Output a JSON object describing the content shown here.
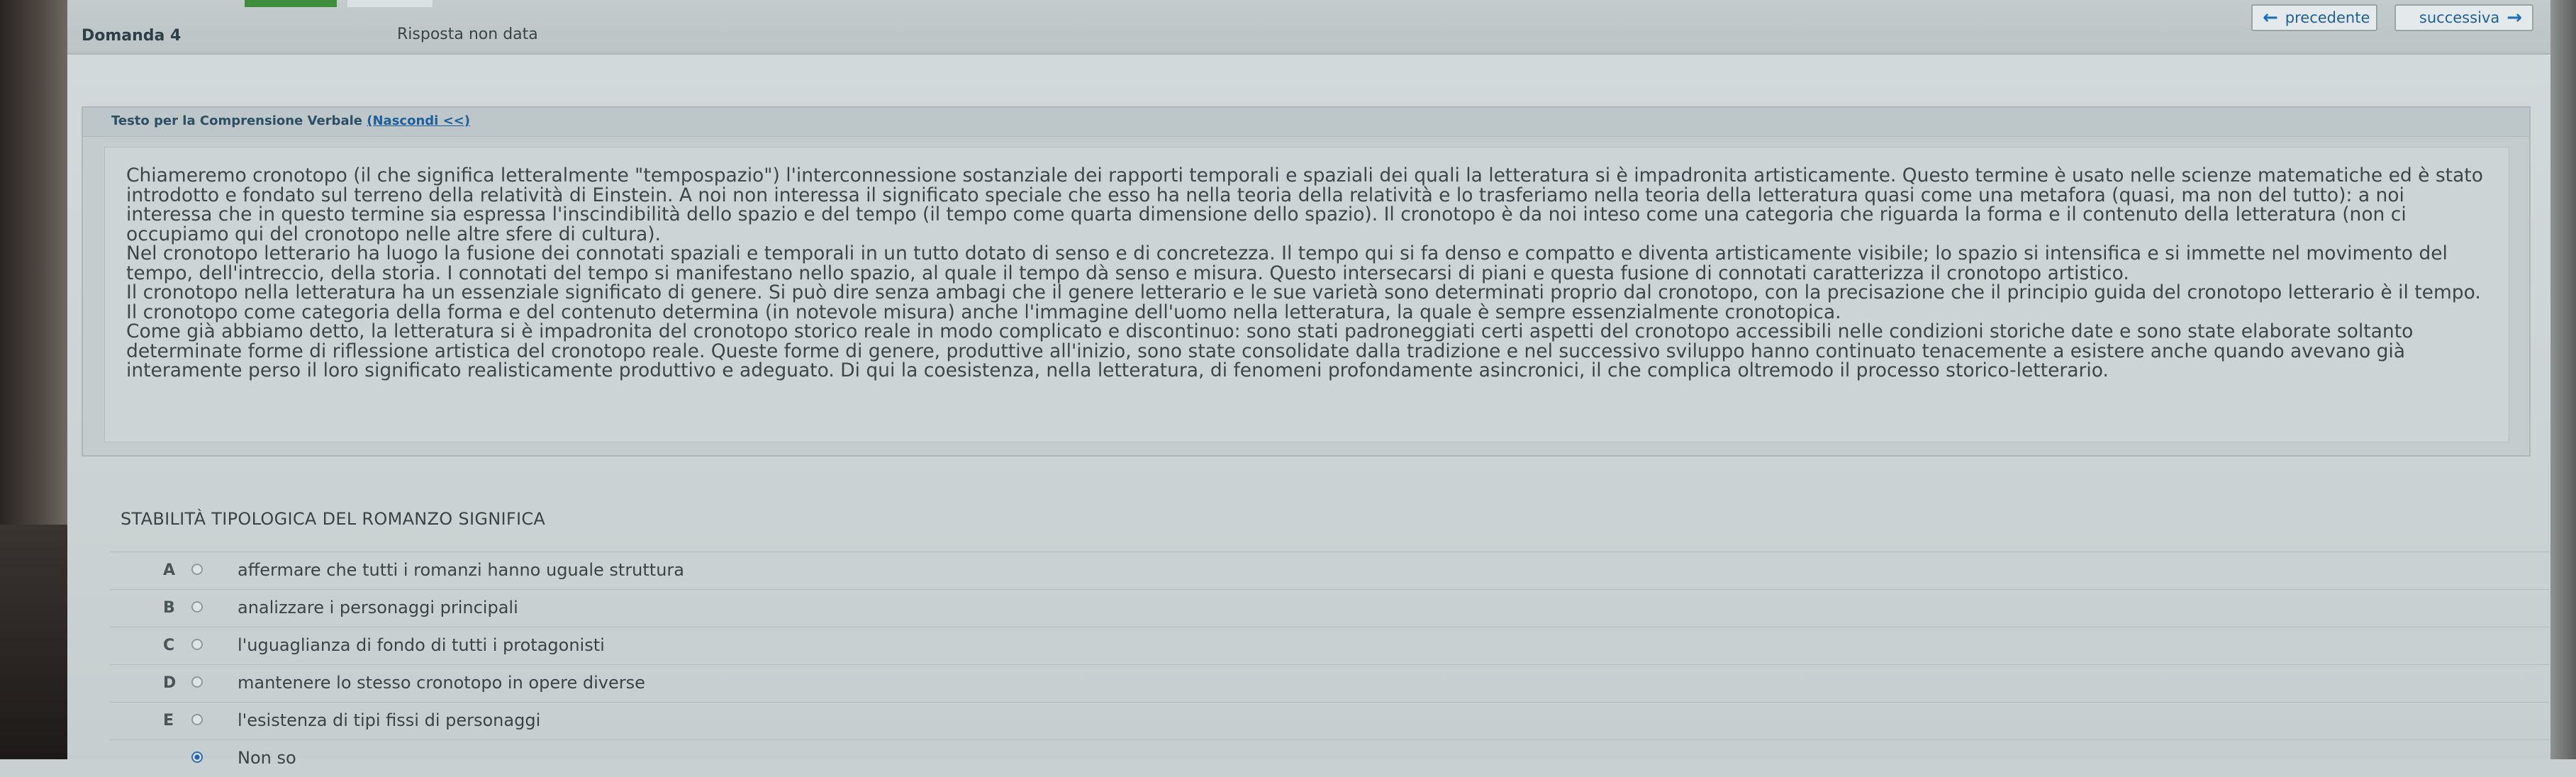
{
  "header": {
    "question_label": "Domanda 4",
    "status": "Risposta non data",
    "prev_label": "precedente",
    "next_label": "successiva"
  },
  "passage": {
    "title": "Testo per la Comprensione Verbale",
    "toggle_link": "(Nascondi <<)",
    "paragraphs": [
      "Chiameremo cronotopo (il che significa letteralmente \"tempospazio\") l'interconnessione sostanziale dei rapporti temporali e spaziali dei quali la letteratura si è impadronita artisticamente. Questo termine è usato nelle scienze matematiche ed è stato introdotto e fondato sul terreno della relatività di Einstein. A noi non interessa il significato speciale che esso ha nella teoria della relatività e lo trasferiamo nella teoria della letteratura quasi come una metafora (quasi, ma non del tutto): a noi interessa che in questo termine sia espressa l'inscindibilità dello spazio e del tempo (il tempo come quarta dimensione dello spazio). Il cronotopo è da noi inteso come una categoria che riguarda la forma e il contenuto della letteratura (non ci occupiamo qui del cronotopo nelle altre sfere di cultura).",
      "Nel cronotopo letterario ha luogo la fusione dei connotati spaziali e temporali in un tutto dotato di senso e di concretezza. Il tempo qui si fa denso e compatto e diventa artisticamente visibile; lo spazio si intensifica e si immette nel movimento del tempo, dell'intreccio, della storia. I connotati del tempo si manifestano nello spazio, al quale il tempo dà senso e misura. Questo intersecarsi di piani e questa fusione di connotati caratterizza il cronotopo artistico.",
      "Il cronotopo nella letteratura ha un essenziale significato di genere. Si può dire senza ambagi che il genere letterario e le sue varietà sono determinati proprio dal cronotopo, con la precisazione che il principio guida del cronotopo letterario è il tempo. Il cronotopo come categoria della forma e del contenuto determina (in notevole misura) anche l'immagine dell'uomo nella letteratura, la quale è sempre essenzialmente cronotopica.",
      "Come già abbiamo detto, la letteratura si è impadronita del cronotopo storico reale in modo complicato e discontinuo: sono stati padroneggiati certi aspetti del cronotopo accessibili nelle condizioni storiche date e sono state elaborate soltanto determinate forme di riflessione artistica del cronotopo reale. Queste forme di genere, produttive all'inizio, sono state consolidate dalla tradizione e nel successivo sviluppo hanno continuato tenacemente a esistere anche quando avevano già interamente perso il loro significato realisticamente produttivo e adeguato. Di qui la coesistenza, nella letteratura, di fenomeni profondamente asincronici, il che complica oltremodo il processo storico-letterario."
    ]
  },
  "question": {
    "text": "STABILITÀ TIPOLOGICA DEL ROMANZO SIGNIFICA",
    "answers": [
      {
        "letter": "A",
        "text": "affermare che tutti i romanzi hanno uguale struttura",
        "selected": false
      },
      {
        "letter": "B",
        "text": "analizzare i personaggi principali",
        "selected": false
      },
      {
        "letter": "C",
        "text": "l'uguaglianza di fondo di tutti i protagonisti",
        "selected": false
      },
      {
        "letter": "D",
        "text": "mantenere lo stesso cronotopo in opere diverse",
        "selected": false
      },
      {
        "letter": "E",
        "text": "l'esistenza di tipi fissi di personaggi",
        "selected": false
      },
      {
        "letter": "",
        "text": "Non so",
        "selected": true
      }
    ]
  },
  "colors": {
    "accent_green": "#3f8e3e",
    "link_blue": "#1f5f9a",
    "radio_selected": "#1f63b5"
  }
}
